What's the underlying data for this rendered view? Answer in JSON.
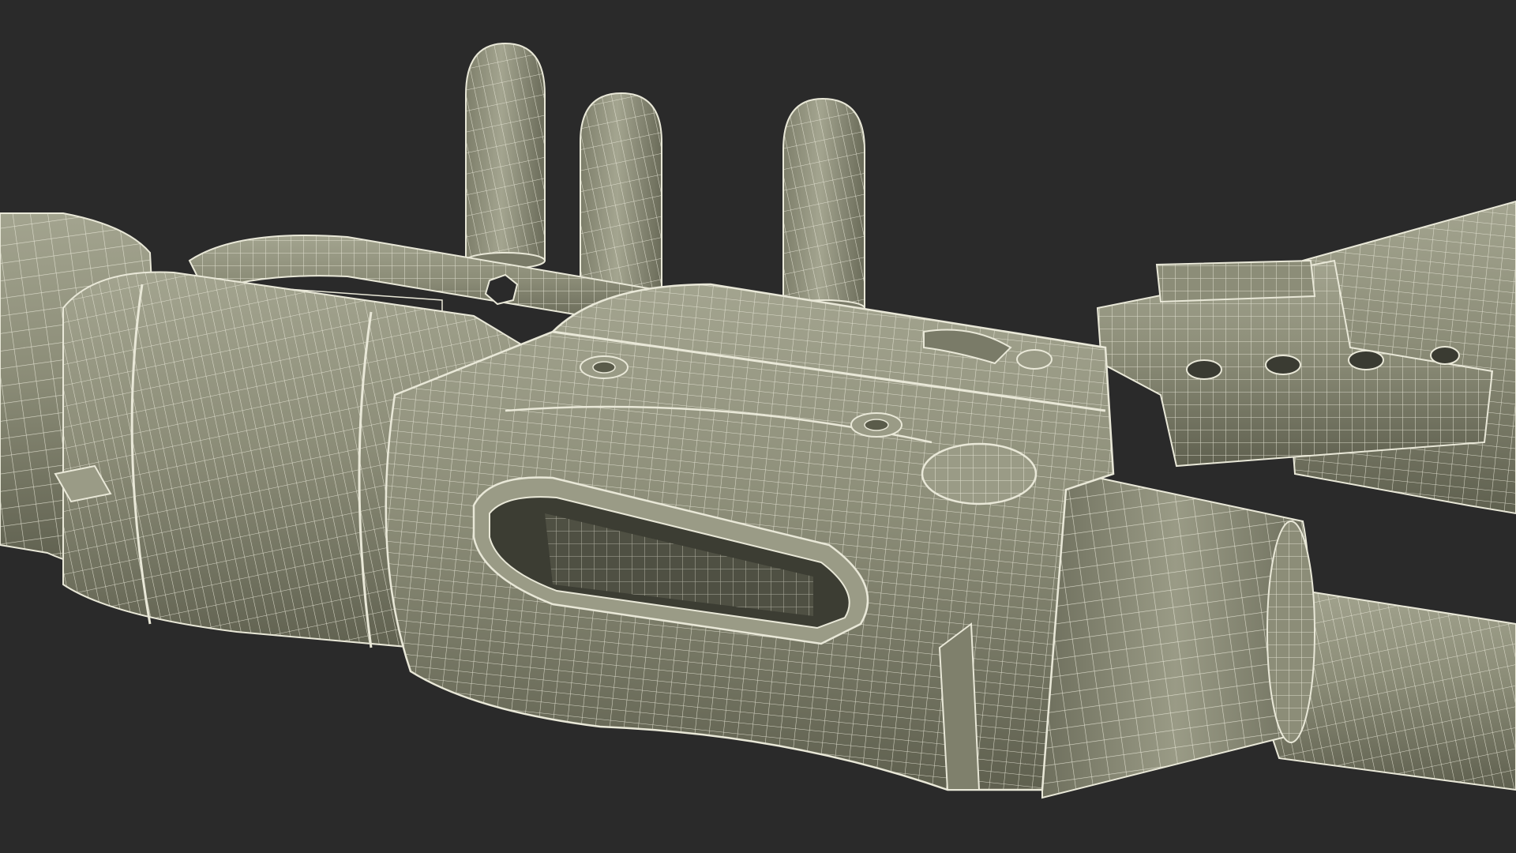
{
  "viewport": {
    "background_color": "#2a2a2a",
    "render_mode": "wireframe-on-shaded"
  },
  "model": {
    "surface_color": "#8c8d78",
    "surface_shadow_color": "#6e6f5d",
    "surface_dark_color": "#4a4b3f",
    "wire_color": "#e9e8d8",
    "parts": [
      "suppressor",
      "barrel-shroud",
      "receiver",
      "ejection-port",
      "charging-handle",
      "rear-sight-block",
      "side-rail",
      "stock",
      "cartridge",
      "cartridge",
      "cartridge"
    ]
  }
}
